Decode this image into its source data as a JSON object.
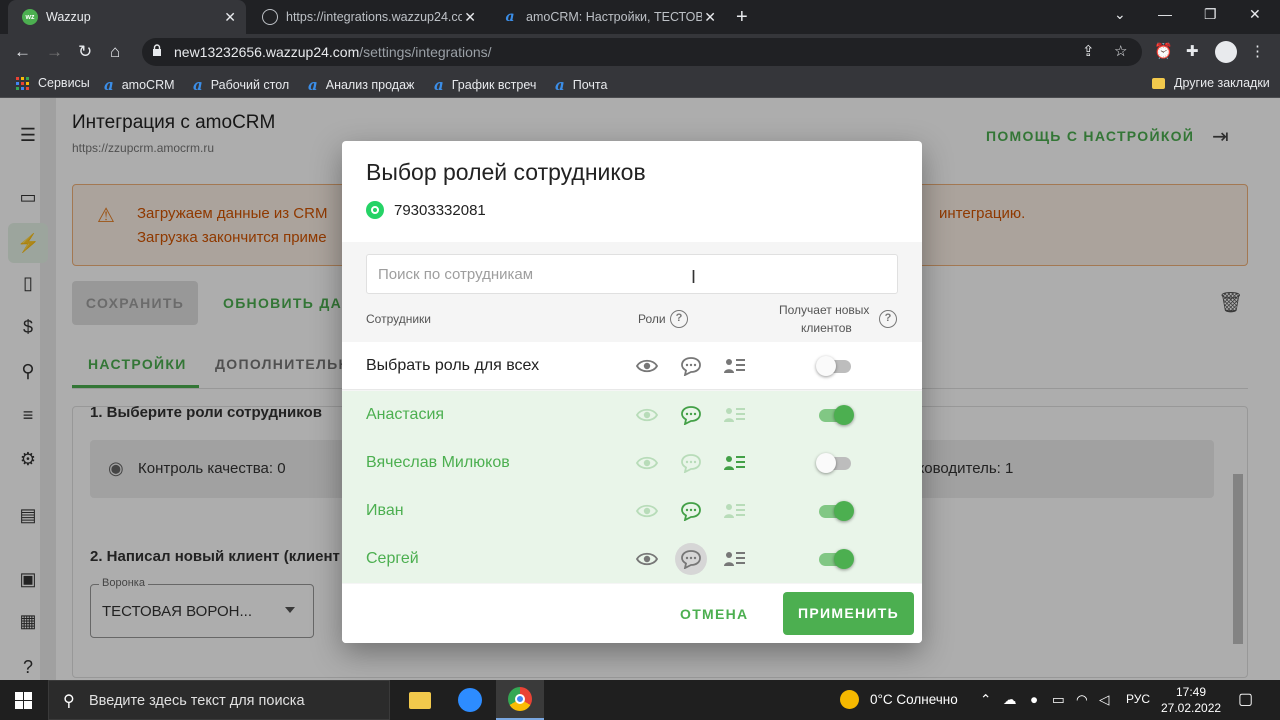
{
  "browser": {
    "tabs": [
      {
        "title": "Wazzup",
        "favicon_text": "wz"
      },
      {
        "title": "https://integrations.wazzup24.co"
      },
      {
        "title": "amoCRM: Настройки, ТЕСТОВАЯ"
      }
    ],
    "url_host": "new13232656.wazzup24.com",
    "url_path": "/settings/integrations/",
    "bookmarks": [
      "Сервисы",
      "amoCRM",
      "Рабочий стол",
      "Анализ продаж",
      "График встреч",
      "Почта"
    ],
    "other_bookmarks": "Другие закладки",
    "bookmark_icon_letter": "a"
  },
  "page": {
    "title": "Интеграция с amoCRM",
    "subtitle_url": "https://zzupcrm.amocrm.ru",
    "help_link": "ПОМОЩЬ С НАСТРОЙКОЙ",
    "alert": {
      "line1": "Загружаем данные из CRM",
      "line2": "Загрузка закончится приме",
      "line1_end": "интеграцию."
    },
    "save_button": "СОХРАНИТЬ",
    "update_button": "ОБНОВИТЬ ДАН",
    "tabs": [
      "НАСТРОЙКИ",
      "ДОПОЛНИТЕЛЬН"
    ],
    "section1_title": "1. Выберите роли сотрудников",
    "role_quality": "Контроль качества: 0",
    "role_manager": "уководитель: 1",
    "section2_title": "2. Написал новый клиент (клиент",
    "funnel_label": "Воронка",
    "funnel_value": "ТЕСТОВАЯ ВОРОН..."
  },
  "modal": {
    "title": "Выбор ролей сотрудников",
    "phone": "79303332081",
    "search_placeholder": "Поиск по сотрудникам",
    "header_employees": "Сотрудники",
    "header_roles": "Роли",
    "header_new_clients_line1": "Получает новых",
    "header_new_clients_line2": "клиентов",
    "help_glyph": "?",
    "select_all_label": "Выбрать роль для всех",
    "select_all_toggle": false,
    "employees": [
      {
        "name": "Анастасия",
        "eye": false,
        "chat": true,
        "list": false,
        "receives_new_clients": true
      },
      {
        "name": "Вячеслав Милюков",
        "eye": false,
        "chat": false,
        "list": true,
        "receives_new_clients": false
      },
      {
        "name": "Иван",
        "eye": false,
        "chat": true,
        "list": false,
        "receives_new_clients": true
      },
      {
        "name": "Сергей",
        "eye": true,
        "chat": true,
        "list": true,
        "receives_new_clients": true
      }
    ],
    "cancel_button": "ОТМЕНА",
    "apply_button": "ПРИМЕНИТЬ"
  },
  "taskbar": {
    "search_placeholder": "Введите здесь текст для поиска",
    "weather": "0°C  Солнечно",
    "language": "РУС",
    "time": "17:49",
    "date": "27.02.2022"
  },
  "colors": {
    "accent_green": "#4caf50",
    "active_role_green": "#43a047",
    "inactive_role_green": "#b8dcb9",
    "alert_orange": "#d35400"
  }
}
